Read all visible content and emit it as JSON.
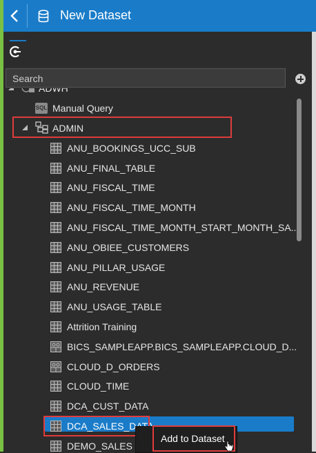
{
  "header": {
    "title": "New Dataset"
  },
  "search": {
    "placeholder": "Search"
  },
  "tree": {
    "root_label": "ADWH",
    "manual_query": "Manual Query",
    "schema": "ADMIN",
    "tables": [
      "ANU_BOOKINGS_UCC_SUB",
      "ANU_FINAL_TABLE",
      "ANU_FISCAL_TIME",
      "ANU_FISCAL_TIME_MONTH",
      "ANU_FISCAL_TIME_MONTH_START_MONTH_SA...",
      "ANU_OBIEE_CUSTOMERS",
      "ANU_PILLAR_USAGE",
      "ANU_REVENUE",
      "ANU_USAGE_TABLE",
      "Attrition Training",
      "BICS_SAMPLEAPP.BICS_SAMPLEAPP.CLOUD_D...",
      "CLOUD_D_ORDERS",
      "CLOUD_TIME",
      "DCA_CUST_DATA",
      "DCA_SALES_DATA",
      "DEMO_SALES"
    ]
  },
  "context_menu": {
    "add_label": "Add to Dataset"
  },
  "colors": {
    "accent": "#1a7cc9",
    "highlight": "#e03c3c",
    "strip": "#7ac143"
  }
}
